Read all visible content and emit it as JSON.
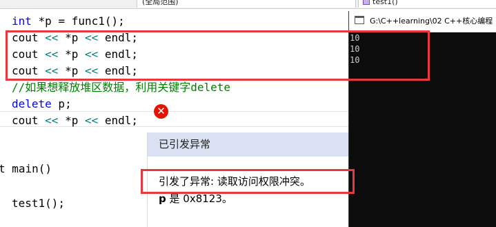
{
  "toolbar": {
    "scope": "(全局范围)",
    "function": "test1()"
  },
  "editor": {
    "lines": [
      {
        "text": "int *p = func1();"
      },
      {
        "text": "cout << *p << endl;"
      },
      {
        "text": "cout << *p << endl;"
      },
      {
        "text": "cout << *p << endl;"
      },
      {
        "text": "//如果想释放堆区数据，利用关键字delete"
      },
      {
        "text": "delete p;"
      },
      {
        "text": "cout << *p << endl;"
      },
      {
        "text": "t main()"
      },
      {
        "text": "test1();"
      }
    ]
  },
  "exception": {
    "title": "已引发异常",
    "message": "引发了异常: 读取访问权限冲突。",
    "detail_var": "p",
    "detail_rest": " 是 0x8123。"
  },
  "console": {
    "title": "G:\\C++learning\\02 C++核心编程",
    "output": [
      "10",
      "10",
      "10"
    ]
  },
  "colors": {
    "keyword": "#0000ff",
    "operator": "#008080",
    "comment": "#008000",
    "annotation": "#e8373d",
    "error": "#e51400",
    "exception_header": "#d9e1f2"
  },
  "icons": {
    "error": "error-icon",
    "console": "console-window-icon",
    "scope": "function-cube-icon"
  }
}
